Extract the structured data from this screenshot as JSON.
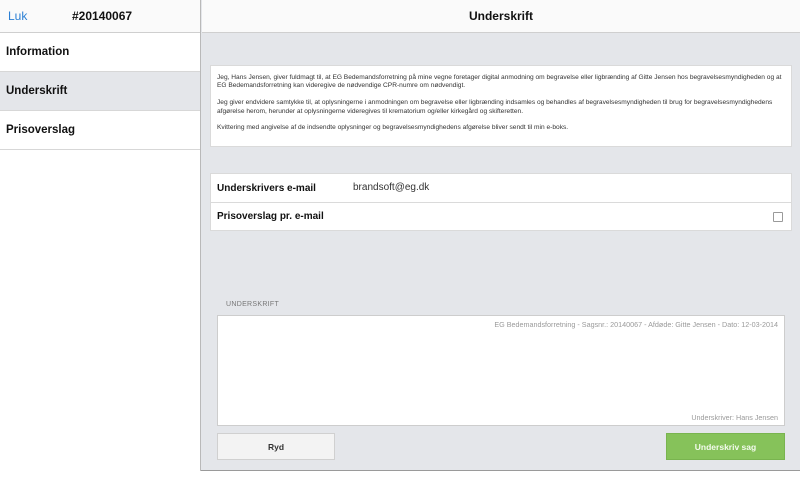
{
  "left": {
    "close_label": "Luk",
    "case_number": "#20140067",
    "nav": [
      {
        "label": "Information"
      },
      {
        "label": "Underskrift"
      },
      {
        "label": "Prisoverslag"
      }
    ]
  },
  "header": {
    "title": "Underskrift"
  },
  "consent": {
    "p1": "Jeg, Hans Jensen, giver fuldmagt til, at EG Bedemandsforretning på mine vegne foretager digital anmodning om begravelse eller ligbrænding af Gitte Jensen hos begravelsesmyndigheden og at EG Bedemandsforretning kan videregive de nødvendige CPR-numre om nødvendigt.",
    "p2": "Jeg giver endvidere samtykke til, at oplysningerne i anmodningen om begravelse eller ligbrænding indsamles og behandles af begravelsesmyndigheden til brug for begravelsesmyndighedens afgørelse herom, herunder at oplysningerne videregives til krematorium og/eller kirkegård og skifteretten.",
    "p3": "Kvittering med angivelse af de indsendte oplysninger og begravelsesmyndighedens afgørelse bliver sendt til min e-boks."
  },
  "form": {
    "email_label": "Underskrivers e-mail",
    "email_value": "brandsoft@eg.dk",
    "quote_label": "Prisoverslag pr. e-mail",
    "quote_checked": false
  },
  "signature": {
    "section_label": "UNDERSKRIFT",
    "meta": "EG Bedemandsforretning - Sagsnr.: 20140067 - Afdøde: Gitte Jensen - Dato: 12-03-2014",
    "signer": "Underskriver: Hans Jensen"
  },
  "buttons": {
    "clear_label": "Ryd",
    "sign_label": "Underskriv sag"
  },
  "colors": {
    "link": "#2a7fd4",
    "sign_button": "#86c25a",
    "background": "#e4e6ea"
  }
}
